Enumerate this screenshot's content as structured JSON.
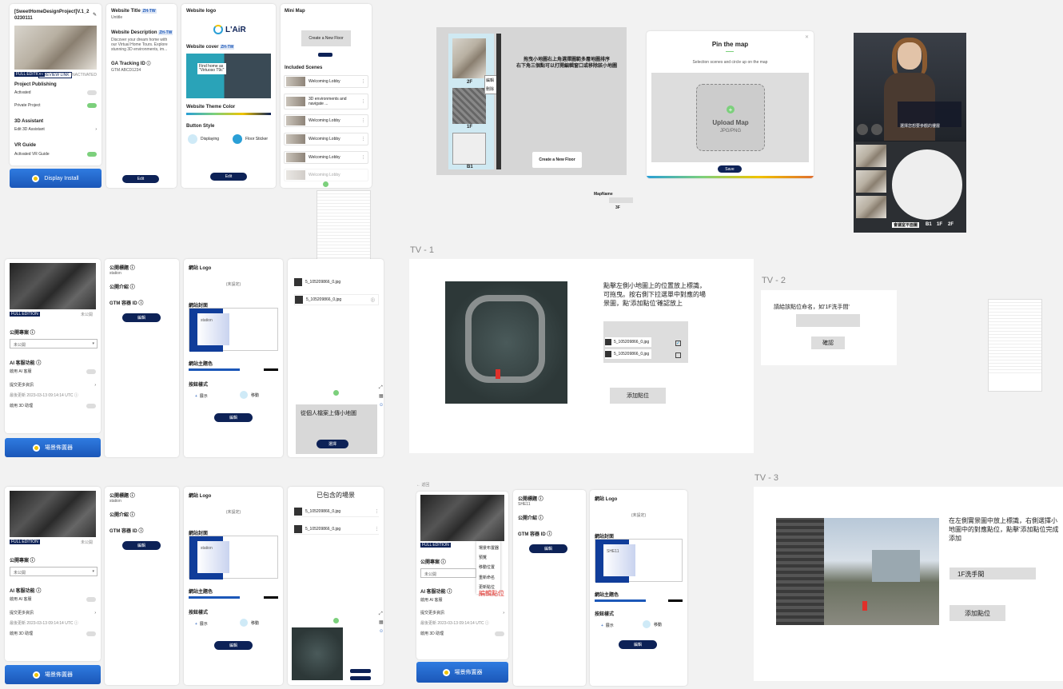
{
  "p1": {
    "project_title": "[SweetHomeDesignProject]V.1_2 0230111",
    "badge_full": "FULL EDITION",
    "badge_preview": "PREVIEW LINK",
    "status": "INACTIVATED",
    "project_publishing": "Project Publishing",
    "activated": "Activated",
    "private_project": "Private Project",
    "assistant_3d": "3D Assistant",
    "edit_assistant": "Edit 3D Assistant",
    "vr_guide": "VR Guide",
    "activated_vr": "Activated VR Guide",
    "display_install": "Display Install"
  },
  "p2": {
    "website_title": "Website Title",
    "title_value": "Untitle",
    "website_description": "Website Description",
    "desc_value": "Discover your dream home with our Virtual Home Tours. Explore stunning 3D environments, im...",
    "ga_label": "GA Tracking ID",
    "ga_value": "GTM ABCD1234",
    "edit": "Edit",
    "zh_tw": "ZH-TW"
  },
  "p3": {
    "website_logo": "Website logo",
    "logo_text": "L'AiR",
    "website_cover": "Website cover",
    "theme_color": "Website Theme Color",
    "button_style": "Button Style",
    "displaying": "Displaying",
    "floor_sticker": "Floor Sticker",
    "edit": "Edit",
    "cover_caption_1": "Find home as",
    "cover_caption_2": "\"Virtuoso T9c\""
  },
  "p4": {
    "mini_map": "Mini Map",
    "create_floor": "Create a New Floor",
    "included_scenes": "Included Scenes",
    "scenes": [
      "Welcoming Lobby",
      "3D environments and navigate ...",
      "Welcoming Lobby",
      "Welcoming Lobby",
      "Welcoming Lobby",
      "Welcoming Lobby"
    ]
  },
  "floor_mock": {
    "instruction_1": "拖曳小地圖右上角選擇圖範多層地圖排序",
    "instruction_2": "右下角三個點可以打開編輯窗口或移除該小地圖",
    "floor_2f": "2F",
    "floor_1f": "1F",
    "floor_b1": "B1",
    "edit": "編輯",
    "delete": "刪除",
    "create_floor": "Create a New Floor"
  },
  "pin_map": {
    "title": "Pin the map",
    "subtitle": "Selection scenes and circle up on the map",
    "upload_map": "Upload Map",
    "formats": "JPG/PNG",
    "save": "Save"
  },
  "mapname": {
    "label": "MapName",
    "value": "3F"
  },
  "avatar": {
    "caption": "選擇您想要參觀的樓層",
    "floors": [
      "B1",
      "1F",
      "2F"
    ],
    "map_label": "會議室平面圖"
  },
  "p5": {
    "badge_full": "FULL EDITION",
    "status": "未公開",
    "public_setting": "公開專案",
    "select": "未公開",
    "ai_features": "AI 客服功能",
    "enable_ai": "啟用 AI 客服",
    "more_info": "提交更多資訊",
    "updated": "最後更新",
    "updated_value": "2023-03-13 09:14:14 UTC",
    "enable_3d": "啟用 3D 助理",
    "bar": "場景佈置器"
  },
  "p6": {
    "public_title": "公開標題",
    "title_value": "station",
    "public_desc": "公開介紹",
    "gtm": "GTM 容器 ID",
    "edit": "編輯"
  },
  "p7": {
    "logo": "網站 Logo",
    "not_set": "(未設定)",
    "cover": "網站封面",
    "cover_caption": "station",
    "theme": "網站主題色",
    "button_style": "按鈕樣式",
    "display": "展示",
    "move": "移動",
    "edit": "編輯"
  },
  "p8": {
    "files": [
      "5_105209866_0.jpg",
      "5_105209866_0.jpg"
    ],
    "upload_prompt": "從個人檔案上傳小地圖",
    "select": "選擇"
  },
  "tv1": {
    "label": "TV - 1",
    "instruction": "點擊左側小地圖上的位置放上標識，可拖曳。按右側下拉選單中對應的場景圖，點'添加點位'確認放上",
    "files": [
      "5_105209866_0.jpg",
      "5_105209866_0.jpg"
    ],
    "add_point": "添加點位"
  },
  "tv2": {
    "label": "TV - 2",
    "prompt": "請給該點位命名，如'1F洗手間'",
    "confirm": "確認"
  },
  "tv3": {
    "label": "TV - 3",
    "instruction": "在左側實景圖中放上標識，右側選擇小地圖中的對應點位，點擊'添加點位完成添加",
    "input_value": "1F洗手間",
    "add_point": "添加點位"
  },
  "p9": {
    "badge_full": "FULL EDITION",
    "status": "未公開",
    "public_setting": "公開專案",
    "select": "未公開",
    "ai_features": "AI 客服功能",
    "enable_ai": "啟用 AI 客服",
    "more_info": "提交更多資訊",
    "updated": "最後更新",
    "updated_value": "2023-03-13 09:14:14 UTC",
    "enable_3d": "啟用 3D 助理",
    "bar": "場景佈置器"
  },
  "p10": {
    "public_title": "公開標題",
    "title_value": "station",
    "public_desc": "公開介紹",
    "gtm": "GTM 容器 ID",
    "edit": "編輯"
  },
  "p11": {
    "logo": "網站 Logo",
    "not_set": "(未設定)",
    "cover": "網站封面",
    "cover_caption": "station",
    "theme": "網站主題色",
    "button_style": "按鈕樣式",
    "display": "展示",
    "move": "移動",
    "edit": "編輯"
  },
  "p12": {
    "heading": "已包含的場景",
    "files": [
      "5_105209866_0.jpg",
      "5_105209866_0.jpg"
    ]
  },
  "p13": {
    "back": "返回",
    "badge_full": "FULL EDITION",
    "menu": [
      "場景布置器",
      "預覽",
      "移動位置",
      "重新命名",
      "更新點位"
    ],
    "edit_point": "編輯點位",
    "public_setting": "公開專案",
    "select": "未公開",
    "ai_features": "AI 客服功能",
    "enable_ai": "啟用 AI 客服",
    "more_info": "提交更多資訊",
    "updated": "最後更新",
    "updated_value": "2023-03-13 09:14:14 UTC",
    "enable_3d": "啟用 3D 助理",
    "bar": "場景佈置器"
  },
  "p14": {
    "public_title": "公開標題",
    "title_value": "SHE11",
    "public_desc": "公開介紹",
    "gtm": "GTM 容器 ID",
    "edit": "編輯"
  },
  "p15": {
    "logo": "網站 Logo",
    "not_set": "(未設定)",
    "cover": "網站封面",
    "cover_caption": "SHE11",
    "theme": "網站主題色",
    "button_style": "按鈕樣式",
    "display": "展示",
    "move": "移動",
    "edit": "編輯"
  },
  "colors": {
    "navy": "#0d2257",
    "blue": "#1b57b8",
    "accent_green": "#7cd07c",
    "yellow": "#f0c400"
  }
}
